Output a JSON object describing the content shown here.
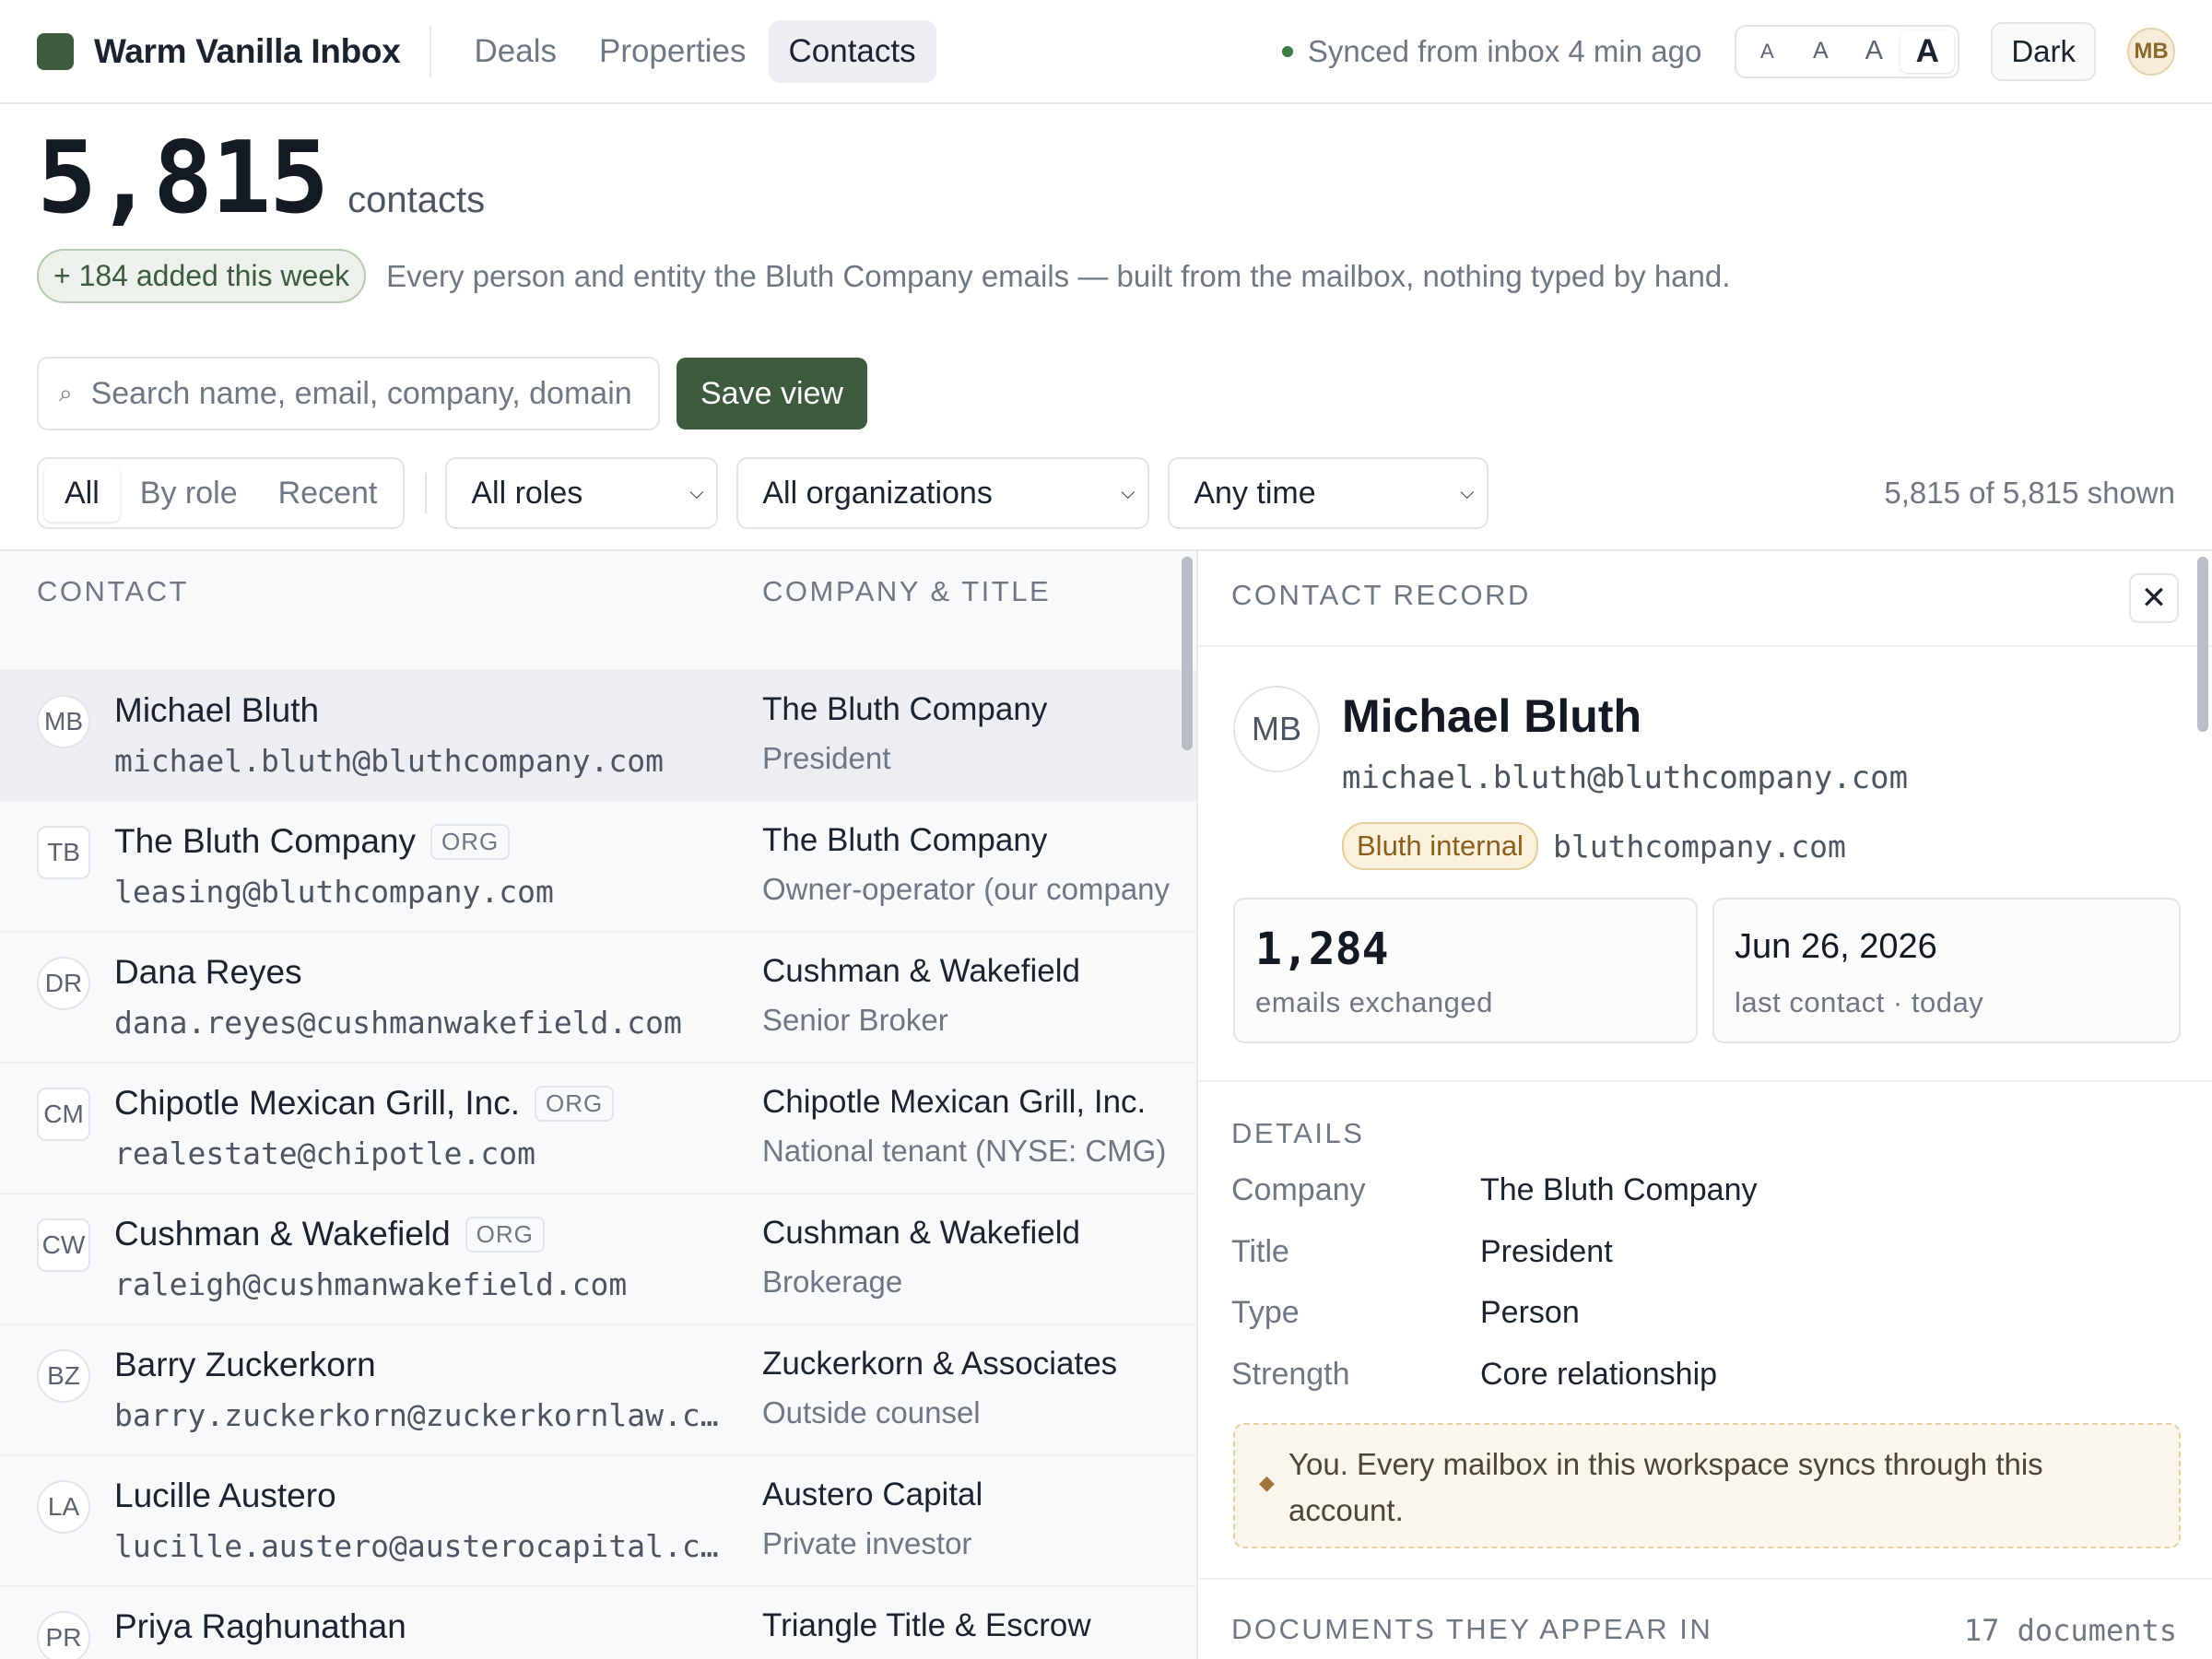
{
  "app": {
    "title": "Warm Vanilla Inbox"
  },
  "nav": {
    "tabs": [
      {
        "label": "Deals"
      },
      {
        "label": "Properties"
      },
      {
        "label": "Contacts"
      }
    ]
  },
  "topbar": {
    "sync_status": "Synced from inbox 4 min ago",
    "font_sizes": [
      "A",
      "A",
      "A",
      "A"
    ],
    "dark_label": "Dark",
    "user_initials": "MB"
  },
  "header": {
    "count": "5,815",
    "unit": "contacts",
    "added_badge": "+ 184 added this week",
    "tagline": "Every person and entity the Bluth Company emails — built from the mailbox, nothing typed by hand."
  },
  "search": {
    "placeholder": "Search name, email, company, domain",
    "value": ""
  },
  "actions": {
    "save_view": "Save view"
  },
  "filters": {
    "segments": [
      "All",
      "By role",
      "Recent"
    ],
    "role_select": "All roles",
    "org_select": "All organizations",
    "time_select": "Any time",
    "shown": "5,815 of 5,815 shown"
  },
  "list": {
    "col_contact": "CONTACT",
    "col_company": "COMPANY & TITLE",
    "rows": [
      {
        "initials": "MB",
        "name": "Michael Bluth",
        "badge": "",
        "email": "michael.bluth@bluthcompany.com",
        "company": "The Bluth Company",
        "title": "President"
      },
      {
        "initials": "TB",
        "name": "The Bluth Company",
        "badge": "ORG",
        "email": "leasing@bluthcompany.com",
        "company": "The Bluth Company",
        "title": "Owner-operator (our company"
      },
      {
        "initials": "DR",
        "name": "Dana Reyes",
        "badge": "",
        "email": "dana.reyes@cushmanwakefield.com",
        "company": "Cushman & Wakefield",
        "title": "Senior Broker"
      },
      {
        "initials": "CM",
        "name": "Chipotle Mexican Grill, Inc.",
        "badge": "ORG",
        "email": "realestate@chipotle.com",
        "company": "Chipotle Mexican Grill, Inc.",
        "title": "National tenant (NYSE: CMG)"
      },
      {
        "initials": "CW",
        "name": "Cushman & Wakefield",
        "badge": "ORG",
        "email": "raleigh@cushmanwakefield.com",
        "company": "Cushman & Wakefield",
        "title": "Brokerage"
      },
      {
        "initials": "BZ",
        "name": "Barry Zuckerkorn",
        "badge": "",
        "email": "barry.zuckerkorn@zuckerkornlaw.com",
        "company": "Zuckerkorn & Associates",
        "title": "Outside counsel"
      },
      {
        "initials": "LA",
        "name": "Lucille Austero",
        "badge": "",
        "email": "lucille.austero@austerocapital.com",
        "company": "Austero Capital",
        "title": "Private investor"
      },
      {
        "initials": "PR",
        "name": "Priya Raghunathan",
        "badge": "",
        "email": "",
        "company": "Triangle Title & Escrow",
        "title": ""
      }
    ]
  },
  "detail": {
    "header": "CONTACT RECORD",
    "initials": "MB",
    "name": "Michael Bluth",
    "email": "michael.bluth@bluthcompany.com",
    "tag": "Bluth internal",
    "domain": "bluthcompany.com",
    "emails_count": "1,284",
    "emails_label": "emails exchanged",
    "last_date": "Jun 26, 2026",
    "last_label": "last contact · today",
    "details_title": "DETAILS",
    "fields": [
      {
        "key": "Company",
        "value": "The Bluth Company"
      },
      {
        "key": "Title",
        "value": "President"
      },
      {
        "key": "Type",
        "value": "Person"
      },
      {
        "key": "Strength",
        "value": "Core relationship"
      }
    ],
    "note": "You. Every mailbox in this workspace syncs through this account.",
    "docs_title": "DOCUMENTS THEY APPEAR IN",
    "docs_count": "17 documents"
  },
  "colors": {
    "brand": "#3e5a3f",
    "internal_tag": "#faf1dd",
    "sync_dot": "#3e7a45"
  }
}
